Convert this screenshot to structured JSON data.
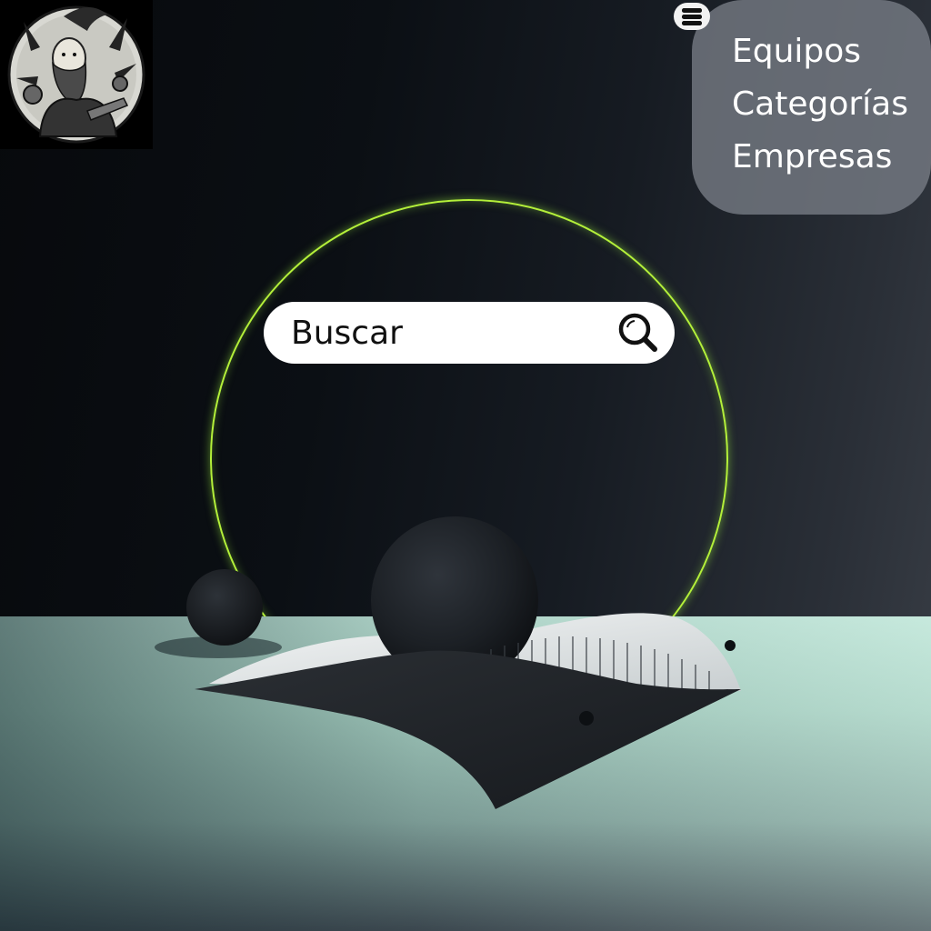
{
  "search": {
    "placeholder": "Buscar",
    "button_icon": "search-icon"
  },
  "nav": {
    "toggle_icon": "menu-icon",
    "items": [
      {
        "label": "Equipos"
      },
      {
        "label": "Categorías"
      },
      {
        "label": "Empresas"
      }
    ]
  },
  "branding": {
    "logo_icon": "wizard-logo-icon"
  },
  "colors": {
    "ring_accent": "#b4f03a",
    "search_background": "#ffffff",
    "menu_panel": "#787e86",
    "menu_text": "#ffffff",
    "floor": "#a9d2c4",
    "background_dark": "#0b0f14"
  }
}
